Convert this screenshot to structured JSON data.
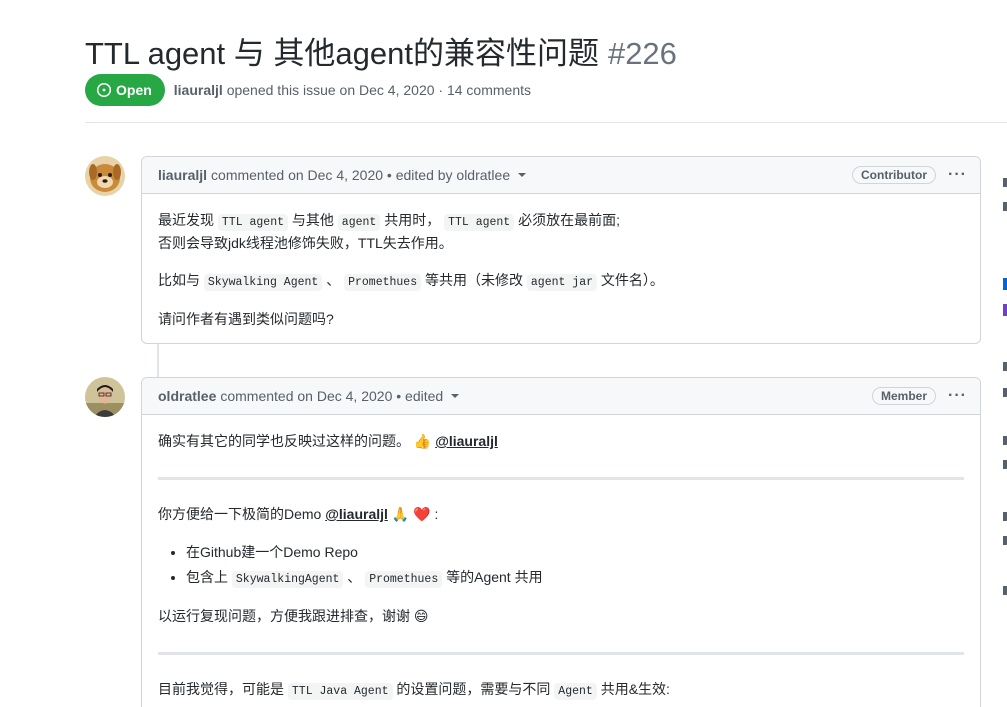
{
  "issue": {
    "title": "TTL agent 与 其他agent的兼容性问题",
    "number": "#226",
    "state": "Open",
    "author": "liauraljl",
    "opened_text": "opened this issue on Dec 4, 2020 · 14 comments"
  },
  "comments": [
    {
      "author": "liauraljl",
      "header_text": "commented on Dec 4, 2020 • edited by oldratlee",
      "role": "Contributor",
      "more_label": "···",
      "body": {
        "l1_a": "最近发现 ",
        "l1_code1": "TTL agent",
        "l1_b": " 与其他 ",
        "l1_code2": "agent",
        "l1_c": " 共用时， ",
        "l1_code3": "TTL agent",
        "l1_d": " 必须放在最前面;",
        "l2": "否则会导致jdk线程池修饰失败，TTL失去作用。",
        "p2_a": "比如与 ",
        "p2_code1": "Skywalking Agent",
        "p2_b": " 、 ",
        "p2_code2": "Promethues",
        "p2_c": " 等共用（未修改 ",
        "p2_code3": "agent jar",
        "p2_d": " 文件名）。",
        "p3": "请问作者有遇到类似问题吗?"
      }
    },
    {
      "author": "oldratlee",
      "header_text": "commented on Dec 4, 2020 • edited",
      "role": "Member",
      "more_label": "···",
      "body": {
        "p1": "确实有其它的同学也反映过这样的问题。",
        "p1_emoji": "👍",
        "p1_mention": "@liauraljl",
        "p2": "你方便给一下极简的Demo ",
        "p2_mention": "@liauraljl",
        "p2_emoji1": "🙏",
        "p2_emoji2": "❤️",
        "p2_end": " :",
        "li1": "在Github建一个Demo Repo",
        "li2_a": "包含上 ",
        "li2_code1": "SkywalkingAgent",
        "li2_b": " 、 ",
        "li2_code2": "Promethues",
        "li2_c": " 等的Agent 共用",
        "p3": "以运行复现问题，方便我跟进排查，谢谢 ",
        "p3_emoji": "😄",
        "p4_a": "目前我觉得，可能是 ",
        "p4_code1": "TTL Java Agent",
        "p4_b": " 的设置问题，需要与不同 ",
        "p4_code2": "Agent",
        "p4_c": " 共用&生效:"
      }
    }
  ]
}
